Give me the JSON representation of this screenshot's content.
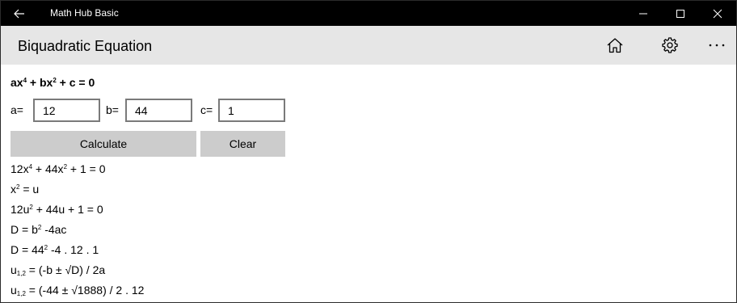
{
  "app": {
    "title": "Math Hub Basic"
  },
  "header": {
    "page_title": "Biquadratic Equation"
  },
  "formula": {
    "p1": "ax",
    "e1": "4",
    "p2": " + bx",
    "e2": "2",
    "p3": " + c = 0"
  },
  "inputs": {
    "a": {
      "label": "a=",
      "value": "12"
    },
    "b": {
      "label": "b=",
      "value": "44"
    },
    "c": {
      "label": "c=",
      "value": "1"
    }
  },
  "buttons": {
    "calculate": "Calculate",
    "clear": "Clear"
  },
  "steps": {
    "l1": {
      "p1": "12x",
      "e1": "4",
      "p2": " + 44x",
      "e2": "2",
      "p3": " + 1 = 0"
    },
    "l2": {
      "p1": "x",
      "e1": "2",
      "p2": " = u"
    },
    "l3": {
      "p1": "12u",
      "e1": "2",
      "p2": " + 44u + 1 = 0"
    },
    "l4": {
      "p1": "D = b",
      "e1": "2",
      "p2": " -4ac"
    },
    "l5": {
      "p1": "D = 44",
      "e1": "2",
      "p2": " -4 . 12 . 1"
    },
    "l6": {
      "p1": "u",
      "sub": "1,2",
      "p2": " = (-b ± √D) / 2a"
    },
    "l7": {
      "p1": "u",
      "sub": "1,2",
      "p2": " = (-44 ± √1888) / 2 . 12"
    }
  }
}
